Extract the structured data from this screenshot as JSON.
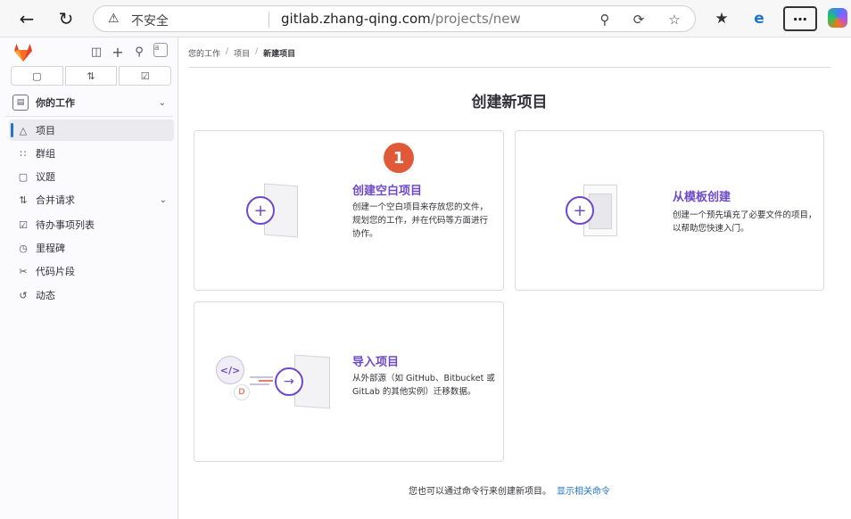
{
  "browser": {
    "insecure_label": "不安全",
    "url_host": "gitlab.zhang-qing.com",
    "url_path": "/projects/new"
  },
  "sidebar": {
    "avatar_alt": "a",
    "section_title": "你的工作",
    "items": [
      {
        "label": "项目"
      },
      {
        "label": "群组"
      },
      {
        "label": "议题"
      },
      {
        "label": "合并请求"
      },
      {
        "label": "待办事项列表"
      },
      {
        "label": "里程碑"
      },
      {
        "label": "代码片段"
      },
      {
        "label": "动态"
      }
    ]
  },
  "breadcrumb": [
    "您的工作",
    "项目",
    "新建项目"
  ],
  "page": {
    "title": "创建新项目",
    "step_badge": "1",
    "cards": [
      {
        "title": "创建空白项目",
        "desc": "创建一个空白项目来存放您的文件，规划您的工作，并在代码等方面进行协作。"
      },
      {
        "title": "从模板创建",
        "desc": "创建一个预先填充了必要文件的项目，以帮助您快速入门。"
      },
      {
        "title": "导入项目",
        "desc": "从外部源（如 GitHub、Bitbucket 或 GitLab 的其他实例）迁移数据。"
      }
    ],
    "footer_text": "您也可以通过命令行来创建新项目。",
    "footer_link": "显示相关命令"
  },
  "icons": {
    "accent": "#6e49cb",
    "badge": "#e05a3a",
    "link": "#1f75cb"
  }
}
